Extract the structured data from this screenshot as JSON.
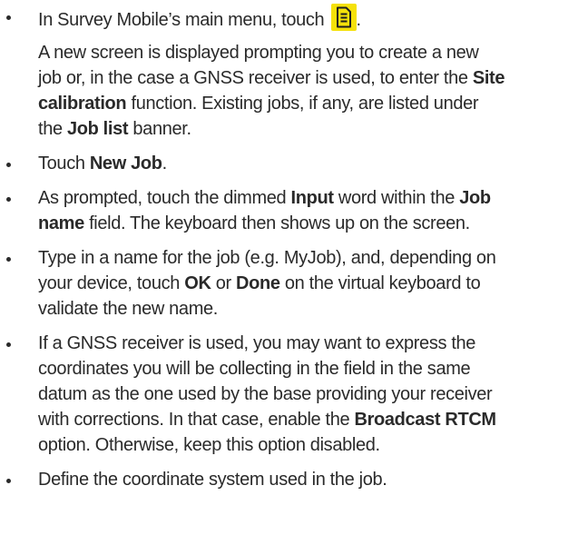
{
  "steps": [
    {
      "intro": "In Survey Mobile’s main menu, touch ",
      "trail": ".",
      "icon": "job-document-icon",
      "icon_color": "#f5e10a",
      "sub": {
        "l1": "A new screen is displayed prompting you to create a new",
        "l2a": "job or, in the case a GNSS receiver is used, to enter the ",
        "site": "Site",
        "calibration": "calibration",
        "l3a": " function. Existing jobs, if any, are listed under",
        "l4a": "the ",
        "job_list": "Job list",
        "l4b": " banner."
      }
    },
    {
      "a": "Touch ",
      "new_job": "New Job",
      "b": "."
    },
    {
      "l1a": "As prompted, touch the dimmed ",
      "input": "Input",
      "l1b": " word within the ",
      "job": "Job",
      "name": "name",
      "l2": " field. The keyboard then shows up on the screen."
    },
    {
      "l1": "Type in a name for the job (e.g. MyJob), and, depending on",
      "l2a": "your device, touch ",
      "ok": "OK",
      "or": " or ",
      "done": "Done",
      "l2b": " on the virtual keyboard to",
      "l3": "validate the new name."
    },
    {
      "l1": "If a GNSS receiver is used, you may want to express the",
      "l2": "coordinates you will be collecting in the field in the same",
      "l3": "datum as the one used by the base providing your receiver",
      "l4a": "with corrections. In that case, enable the ",
      "rtcm": "Broadcast RTCM",
      "l5": "option. Otherwise, keep this option disabled."
    },
    {
      "l1": "Define the coordinate system used in the job."
    }
  ]
}
